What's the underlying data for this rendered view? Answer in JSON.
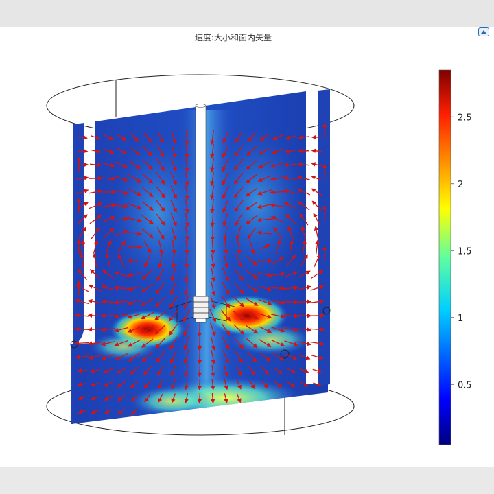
{
  "plot": {
    "title": "速度:大小和面内矢量"
  },
  "colorbar": {
    "ticks": [
      "2.5",
      "2",
      "1.5",
      "1",
      "0.5"
    ],
    "tick_values": [
      2.5,
      2,
      1.5,
      1,
      0.5
    ],
    "range": [
      0.05,
      2.85
    ],
    "colormap": "jet"
  },
  "colors": {
    "arrow": "#d11414",
    "field_low": "#1a2fa8",
    "field_high": "#a00000"
  }
}
